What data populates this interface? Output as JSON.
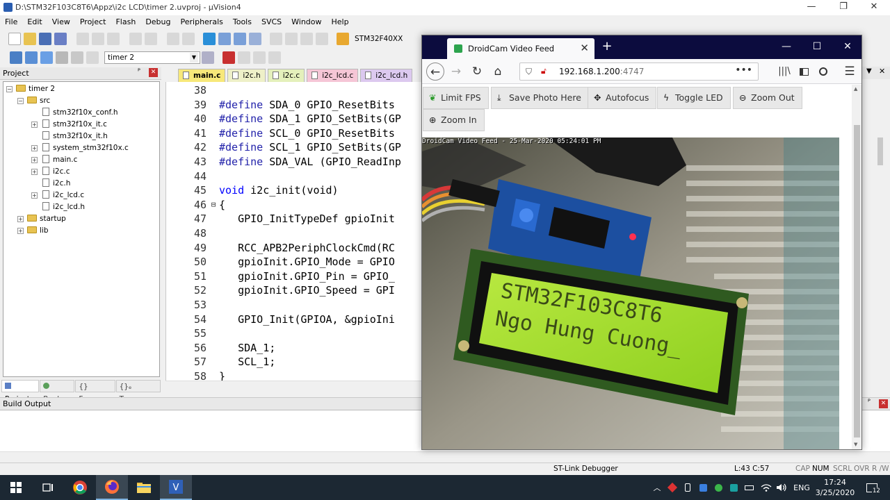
{
  "window": {
    "title": "D:\\STM32F103C8T6\\Appz\\i2c LCD\\timer 2.uvproj - µVision4",
    "controls": {
      "minimize": "—",
      "maximize": "❐",
      "close": "✕"
    }
  },
  "menu": [
    "File",
    "Edit",
    "View",
    "Project",
    "Flash",
    "Debug",
    "Peripherals",
    "Tools",
    "SVCS",
    "Window",
    "Help"
  ],
  "toolbar": {
    "device": "STM32F40XX",
    "target": "timer 2"
  },
  "project_panel": {
    "title": "Project",
    "pin": "ᴾ",
    "close": "✕",
    "tree": [
      {
        "label": "timer 2",
        "type": "folder",
        "expand": "−"
      },
      {
        "label": "src",
        "type": "folder",
        "expand": "−"
      },
      {
        "label": "stm32f10x_conf.h",
        "type": "file"
      },
      {
        "label": "stm32f10x_it.c",
        "type": "file",
        "expand": "+"
      },
      {
        "label": "stm32f10x_it.h",
        "type": "file"
      },
      {
        "label": "system_stm32f10x.c",
        "type": "file",
        "expand": "+"
      },
      {
        "label": "main.c",
        "type": "file",
        "expand": "+"
      },
      {
        "label": "i2c.c",
        "type": "file",
        "expand": "+"
      },
      {
        "label": "i2c.h",
        "type": "file"
      },
      {
        "label": "i2c_lcd.c",
        "type": "file",
        "expand": "+"
      },
      {
        "label": "i2c_lcd.h",
        "type": "file"
      },
      {
        "label": "startup",
        "type": "folder",
        "expand": "+"
      },
      {
        "label": "lib",
        "type": "folder",
        "expand": "+"
      }
    ],
    "tabs": [
      "Project",
      "Books",
      "{} Func...",
      "{}ₑ Temp..."
    ]
  },
  "editor": {
    "tabs": [
      {
        "label": "main.c",
        "color": "#f7e87a",
        "active": true
      },
      {
        "label": "i2c.h",
        "color": "#eef0c8"
      },
      {
        "label": "i2c.c",
        "color": "#e4f0bb"
      },
      {
        "label": "i2c_lcd.c",
        "color": "#f5c6d6"
      },
      {
        "label": "i2c_lcd.h",
        "color": "#dcc9ef"
      }
    ],
    "lines": [
      {
        "n": "38",
        "fold": "",
        "code": ""
      },
      {
        "n": "39",
        "fold": "",
        "code": "#define SDA_0 GPIO_ResetBits"
      },
      {
        "n": "40",
        "fold": "",
        "code": "#define SDA_1 GPIO_SetBits(GP"
      },
      {
        "n": "41",
        "fold": "",
        "code": "#define SCL_0 GPIO_ResetBits"
      },
      {
        "n": "42",
        "fold": "",
        "code": "#define SCL_1 GPIO_SetBits(GP"
      },
      {
        "n": "43",
        "fold": "",
        "code": "#define SDA_VAL (GPIO_ReadInp"
      },
      {
        "n": "44",
        "fold": "",
        "code": ""
      },
      {
        "n": "45",
        "fold": "",
        "code": "void i2c_init(void)"
      },
      {
        "n": "46",
        "fold": "⊟",
        "code": "{"
      },
      {
        "n": "47",
        "fold": "",
        "code": "   GPIO_InitTypeDef gpioInit"
      },
      {
        "n": "48",
        "fold": "",
        "code": ""
      },
      {
        "n": "49",
        "fold": "",
        "code": "   RCC_APB2PeriphClockCmd(RC"
      },
      {
        "n": "50",
        "fold": "",
        "code": "   gpioInit.GPIO_Mode = GPIO"
      },
      {
        "n": "51",
        "fold": "",
        "code": "   gpioInit.GPIO_Pin = GPIO_"
      },
      {
        "n": "52",
        "fold": "",
        "code": "   gpioInit.GPIO_Speed = GPI"
      },
      {
        "n": "53",
        "fold": "",
        "code": ""
      },
      {
        "n": "54",
        "fold": "",
        "code": "   GPIO_Init(GPIOA, &gpioIni"
      },
      {
        "n": "55",
        "fold": "",
        "code": ""
      },
      {
        "n": "56",
        "fold": "",
        "code": "   SDA_1;"
      },
      {
        "n": "57",
        "fold": "",
        "code": "   SCL_1;"
      },
      {
        "n": "58",
        "fold": "",
        "code": "}"
      }
    ]
  },
  "build_output": {
    "title": "Build Output"
  },
  "statusbar": {
    "debugger": "ST-Link Debugger",
    "position": "L:43 C:57",
    "caps": "CAP",
    "num": "NUM",
    "scrl": "SCRL",
    "ovr": "OVR",
    "rw": "R /W"
  },
  "taskbar": {
    "time": "17:24",
    "date": "3/25/2020",
    "lang": "ENG",
    "notifications": "12"
  },
  "firefox": {
    "tab_title": "DroidCam Video Feed",
    "tab_close": "✕",
    "new_tab": "+",
    "controls": {
      "minimize": "—",
      "maximize": "☐",
      "close": "✕"
    },
    "url_host": "192.168.1.200",
    "url_port": ":4747",
    "url_menu": "•••",
    "buttons": [
      {
        "label": "Limit FPS",
        "icon": "leaf-icon"
      },
      {
        "label": "Save Photo Here",
        "icon": "download-icon"
      },
      {
        "label": "Autofocus",
        "icon": "crosshair-icon"
      },
      {
        "label": "Toggle LED",
        "icon": "bolt-icon"
      },
      {
        "label": "Zoom Out",
        "icon": "zoom-out-icon"
      },
      {
        "label": "Zoom In",
        "icon": "zoom-in-icon"
      }
    ],
    "feed_timestamp": "DroidCam Video Feed - 25-Mar-2020 05:24:01 PM",
    "lcd_line1": "STM32F103C8T6",
    "lcd_line2": "Ngo Hung Cuong_"
  }
}
